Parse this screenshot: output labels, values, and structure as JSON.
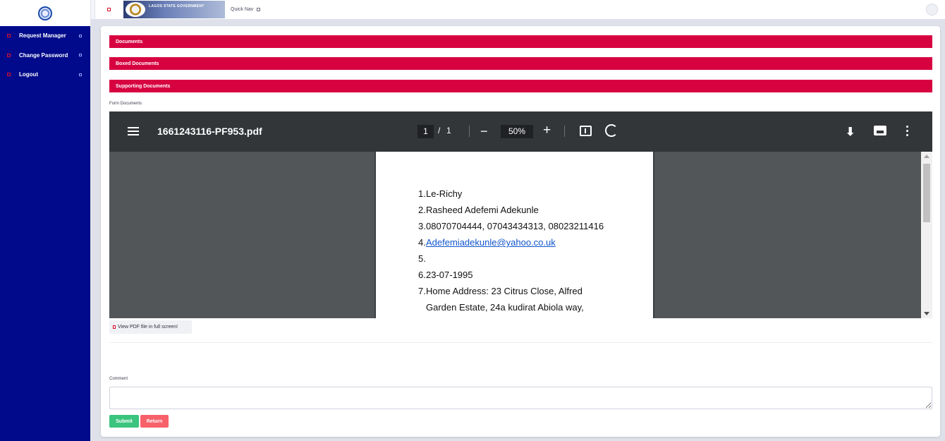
{
  "sidebar": {
    "items": [
      {
        "label": "Request Manager"
      },
      {
        "label": "Change Password"
      },
      {
        "label": "Logout"
      }
    ]
  },
  "header": {
    "banner_text": "LAGOS STATE GOVERNMENT",
    "quick_nav_label": "Quick Nav"
  },
  "sections": {
    "documents": "Documents",
    "boxed_documents": "Boxed Documents",
    "supporting_documents": "Supporting Documents",
    "form_documents_label": "Form Documents"
  },
  "pdf_viewer": {
    "file_name": "1661243116-PF953.pdf",
    "current_page": "1",
    "page_separator": "/",
    "total_pages": "1",
    "zoom": "50%",
    "minus_label": "−",
    "plus_label": "+",
    "download_label": "⬇",
    "lines": [
      {
        "num": "1.",
        "text": "Le-Richy"
      },
      {
        "num": "2.",
        "text": "Rasheed Adefemi Adekunle"
      },
      {
        "num": "3.",
        "text": "08070704444, 07043434313, 08023211416"
      },
      {
        "num": "4.",
        "text": "Adefemiadekunle@yahoo.co.uk"
      },
      {
        "num": "5.",
        "text": ""
      },
      {
        "num": "6.",
        "text": "23-07-1995"
      },
      {
        "num": "7.",
        "text": "Home Address: 23 Citrus Close, Alfred"
      },
      {
        "num": "",
        "text": "Garden Estate, 24a kudirat Abiola way,"
      }
    ]
  },
  "fullscreen_label": "View PDF file in full screen!",
  "comment": {
    "label": "Comment",
    "value": ""
  },
  "actions": {
    "submit": "Submit",
    "return": "Return"
  },
  "colors": {
    "sidebar_bg": "#000a8a",
    "section_bar": "#d70341",
    "submit": "#3ac47d",
    "return": "#f7616a"
  }
}
